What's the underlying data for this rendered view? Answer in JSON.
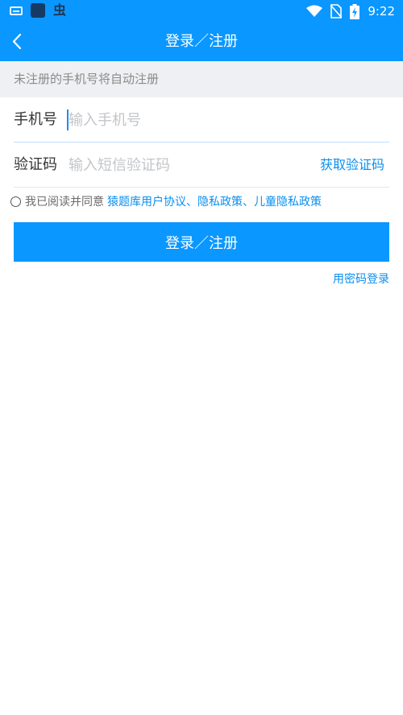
{
  "status_bar": {
    "time": "9:22"
  },
  "header": {
    "title": "登录／注册"
  },
  "notice": "未注册的手机号将自动注册",
  "form": {
    "phone_label": "手机号",
    "phone_placeholder": "输入手机号",
    "phone_value": "",
    "code_label": "验证码",
    "code_placeholder": "输入短信验证码",
    "code_value": "",
    "get_code_label": "获取验证码"
  },
  "agreement": {
    "prefix": "我已阅读并同意",
    "links": "猿题库用户协议、隐私政策、儿童隐私政策",
    "checked": false
  },
  "primary_button": "登录／注册",
  "password_login_link": "用密码登录",
  "colors": {
    "primary": "#0a97ff",
    "link": "#0a8fef"
  }
}
